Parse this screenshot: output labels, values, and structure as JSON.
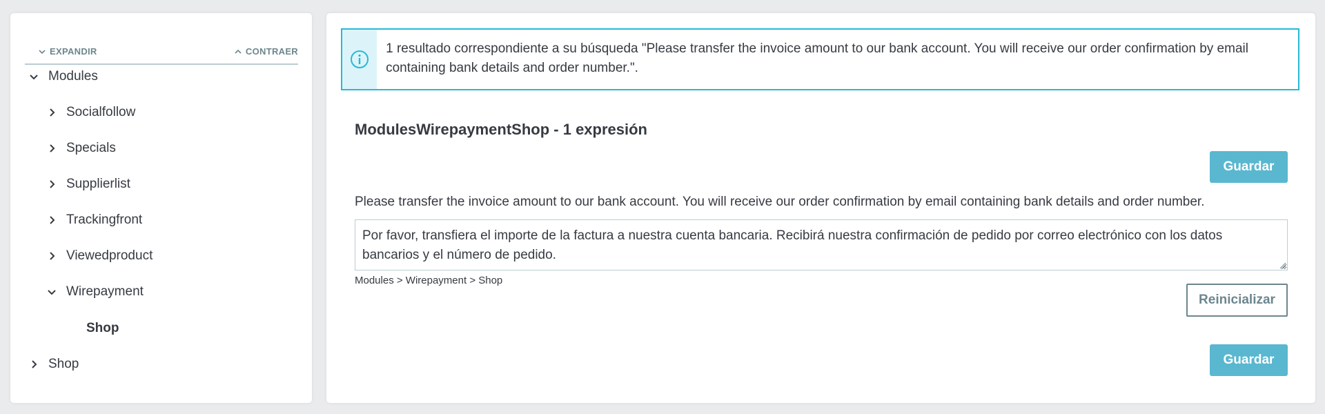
{
  "sidebar": {
    "expand_label": "EXPANDIR",
    "collapse_label": "CONTRAER",
    "tree": [
      {
        "label": "Modules",
        "state": "expanded"
      },
      {
        "label": "Socialfollow",
        "state": "collapsed"
      },
      {
        "label": "Specials",
        "state": "collapsed"
      },
      {
        "label": "Supplierlist",
        "state": "collapsed"
      },
      {
        "label": "Trackingfront",
        "state": "collapsed"
      },
      {
        "label": "Viewedproduct",
        "state": "collapsed"
      },
      {
        "label": "Wirepayment",
        "state": "expanded"
      },
      {
        "label": "Shop",
        "state": "selected"
      },
      {
        "label": "Shop",
        "state": "collapsed"
      }
    ]
  },
  "alert": {
    "icon": "info-icon",
    "message": "1 resultado correspondiente a su búsqueda \"Please transfer the invoice amount to our bank account. You will receive our order confirmation by email containing bank details and order number.\"."
  },
  "main": {
    "section_title": "ModulesWirepaymentShop - 1 expresión",
    "save_label": "Guardar",
    "source_text": "Please transfer the invoice amount to our bank account. You will receive our order confirmation by email containing bank details and order number.",
    "translation_value": "Por favor, transfiera el importe de la factura a nuestra cuenta bancaria. Recibirá nuestra confirmación de pedido por correo electrónico con los datos bancarios y el número de pedido.",
    "breadcrumb": "Modules > Wirepayment > Shop",
    "reset_label": "Reinicializar"
  },
  "colors": {
    "accent": "#25b9d7",
    "primary_button": "#5ab7d0",
    "alert_icon_bg": "#dcf4f9",
    "muted": "#6c868e"
  }
}
